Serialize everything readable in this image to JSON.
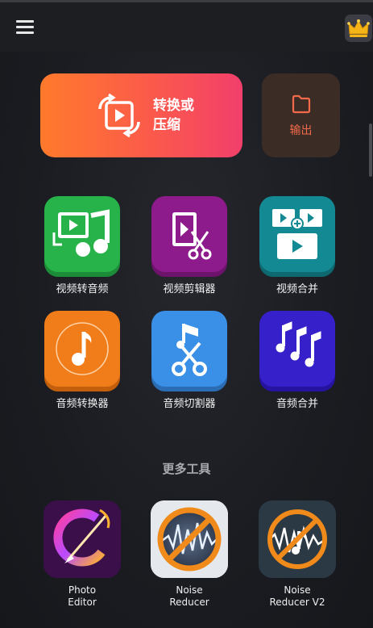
{
  "header": {
    "menu_icon": "hamburger-menu-icon",
    "premium_icon": "crown-icon"
  },
  "actions": {
    "convert_label_line1": "转换或",
    "convert_label_line2": "压缩",
    "output_label": "输出"
  },
  "tools": [
    {
      "label": "视频转音频",
      "color": "#27b24a",
      "icon": "video-to-audio-icon"
    },
    {
      "label": "视频剪辑器",
      "color": "#8e1b8c",
      "icon": "video-cutter-icon"
    },
    {
      "label": "视频合并",
      "color": "#138a93",
      "icon": "video-merge-icon"
    },
    {
      "label": "音频转换器",
      "color": "#f07d1a",
      "icon": "audio-converter-icon"
    },
    {
      "label": "音频切割器",
      "color": "#3a8fe6",
      "icon": "audio-cutter-icon"
    },
    {
      "label": "音频合并",
      "color": "#3520c9",
      "icon": "audio-merge-icon"
    }
  ],
  "more_tools": {
    "title": "更多工具",
    "apps": [
      {
        "line1": "Photo",
        "line2": "Editor"
      },
      {
        "line1": "Noise",
        "line2": "Reducer"
      },
      {
        "line1": "Noise",
        "line2": "Reducer V2"
      }
    ]
  },
  "colors": {
    "convert_start": "#ff7a2c",
    "convert_end": "#f23f6b",
    "output_text": "#f26a4a"
  }
}
